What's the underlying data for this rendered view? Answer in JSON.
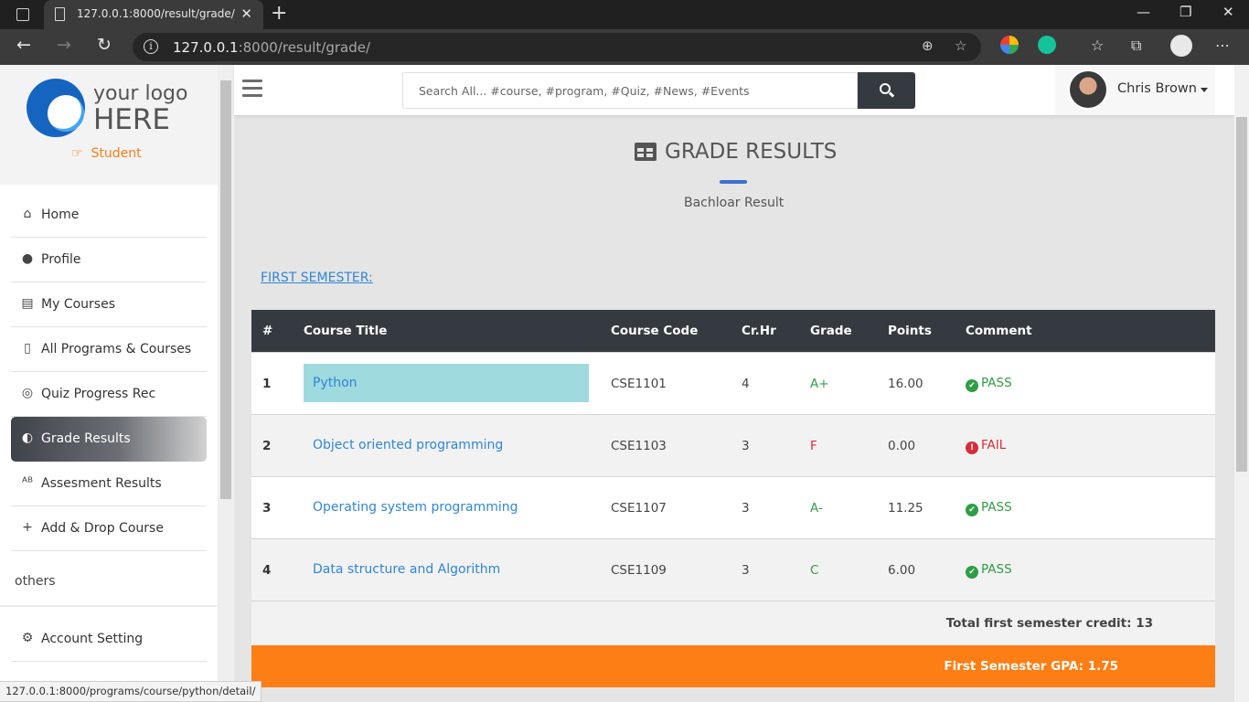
{
  "browser": {
    "tab_title": "127.0.0.1:8000/result/grade/",
    "tab_close": "✕",
    "new_tab": "+",
    "url_host": "127.0.0.1",
    "url_path": ":8000/result/grade/",
    "back": "←",
    "forward": "→",
    "reload": "↻",
    "minimize": "—",
    "restore": "❐",
    "close": "✕",
    "more": "⋯",
    "zoom_icon": "⊕",
    "favorite_icon": "☆",
    "favorites_icon": "☆",
    "collections_icon": "⧉"
  },
  "sidebar": {
    "logo_line1": "your logo",
    "logo_line2": "HERE",
    "role": "Student",
    "role_icon": "☞",
    "items": [
      {
        "label": "Home",
        "icon": "⌂"
      },
      {
        "label": "Profile",
        "icon": "●"
      },
      {
        "label": "My Courses",
        "icon": "▤"
      },
      {
        "label": "All Programs & Courses",
        "icon": "▯"
      },
      {
        "label": "Quiz Progress Rec",
        "icon": "◎"
      },
      {
        "label": "Grade Results",
        "icon": "◐"
      },
      {
        "label": "Assesment Results",
        "icon": "ᴬᴮ"
      },
      {
        "label": "Add & Drop Course",
        "icon": "+"
      }
    ],
    "others_label": "others",
    "bottom_items": [
      {
        "label": "Account Setting",
        "icon": "⚙"
      }
    ]
  },
  "header": {
    "search_placeholder": "Search All... #course, #program, #Quiz, #News, #Events",
    "user_name": "Chris Brown"
  },
  "main": {
    "title": "GRADE RESULTS",
    "subtitle": "Bachloar Result",
    "semester_link": "FIRST SEMESTER:",
    "columns": [
      "#",
      "Course Title",
      "Course Code",
      "Cr.Hr",
      "Grade",
      "Points",
      "Comment"
    ],
    "rows": [
      {
        "no": "1",
        "title": "Python",
        "code": "CSE1101",
        "cr": "4",
        "grade": "A+",
        "points": "16.00",
        "comment": "PASS"
      },
      {
        "no": "2",
        "title": "Object oriented programming",
        "code": "CSE1103",
        "cr": "3",
        "grade": "F",
        "points": "0.00",
        "comment": "FAIL"
      },
      {
        "no": "3",
        "title": "Operating system programming",
        "code": "CSE1107",
        "cr": "3",
        "grade": "A-",
        "points": "11.25",
        "comment": "PASS"
      },
      {
        "no": "4",
        "title": "Data structure and Algorithm",
        "code": "CSE1109",
        "cr": "3",
        "grade": "C",
        "points": "6.00",
        "comment": "PASS"
      }
    ],
    "total_credit": "Total first semester credit: 13",
    "gpa": "First Semester GPA: 1.75"
  },
  "status_bar": {
    "link_preview": "127.0.0.1:8000/programs/course/python/detail/"
  },
  "colors": {
    "accent_orange": "#fd7e14",
    "table_header": "#343a40",
    "pass": "#2e9e44",
    "fail": "#d62f3a",
    "link": "#2f86d8"
  }
}
